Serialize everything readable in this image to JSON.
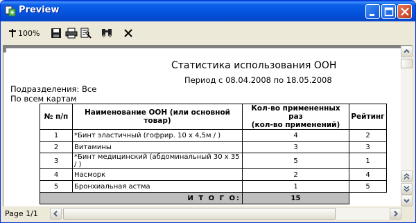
{
  "window": {
    "title": "Preview"
  },
  "toolbar": {
    "zoom_label": "100%",
    "buttons": [
      "zoom-icon",
      "save-icon",
      "print-icon",
      "page-setup-icon",
      "find-icon",
      "close-icon"
    ]
  },
  "report": {
    "title": "Статистика использования ООН",
    "period": "Период  с 08.04.2008 по 18.05.2008",
    "department": "Подразделения: Все",
    "scope": "По всем картам",
    "columns": {
      "num": "№ п/п",
      "name": "Наименование ООН (или основной товар)",
      "used_line1": "Кол-во примененных раз",
      "used_line2": "(кол-во применений)",
      "rank": "Рейтинг"
    },
    "rows": [
      {
        "num": "1",
        "name": "*Бинт эластичный (гофрир. 10 х 4,5м / )",
        "used": "4",
        "rank": "2"
      },
      {
        "num": "2",
        "name": "Витамины",
        "used": "3",
        "rank": "3"
      },
      {
        "num": "3",
        "name": "*Бинт медицинский (абдоминальный 30 х 35 / )",
        "used": "5",
        "rank": "1"
      },
      {
        "num": "4",
        "name": "Насморк",
        "used": "2",
        "rank": "4"
      },
      {
        "num": "5",
        "name": "Бронхиальная астма",
        "used": "1",
        "rank": "5"
      }
    ],
    "total_label": "И Т О Г О:",
    "total_value": "15"
  },
  "status": {
    "page": "Page 1/1"
  },
  "colors": {
    "titlebar": "#0A5FE8",
    "total_row": "#BEBEBE"
  }
}
